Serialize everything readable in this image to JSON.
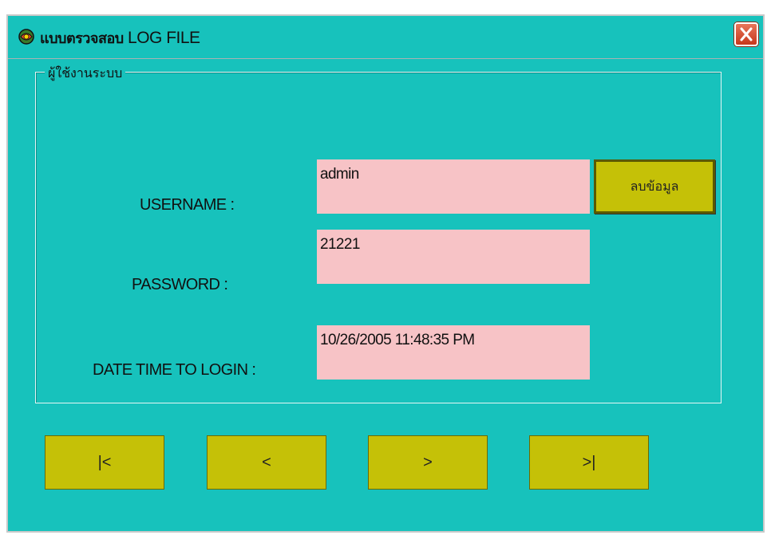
{
  "window": {
    "title_thai": "แบบตรวจสอบ",
    "title_latin": "LOG FILE",
    "close_glyph": "X"
  },
  "group": {
    "legend": "ผู้ใช้งานระบบ"
  },
  "fields": {
    "username_label": "USERNAME :",
    "username_value": "admin",
    "password_label": "PASSWORD :",
    "password_value": "21221",
    "datetime_label": "DATE TIME TO LOGIN :",
    "datetime_value": "10/26/2005 11:48:35 PM"
  },
  "buttons": {
    "delete_label": "ลบข้อมูล",
    "first_label": "|<",
    "prev_label": "<",
    "next_label": ">",
    "last_label": ">|"
  },
  "colors": {
    "window_bg": "#17c2bc",
    "field_bg": "#f7c3c6",
    "button_bg": "#c5c107",
    "close_bg": "#d2502f"
  }
}
